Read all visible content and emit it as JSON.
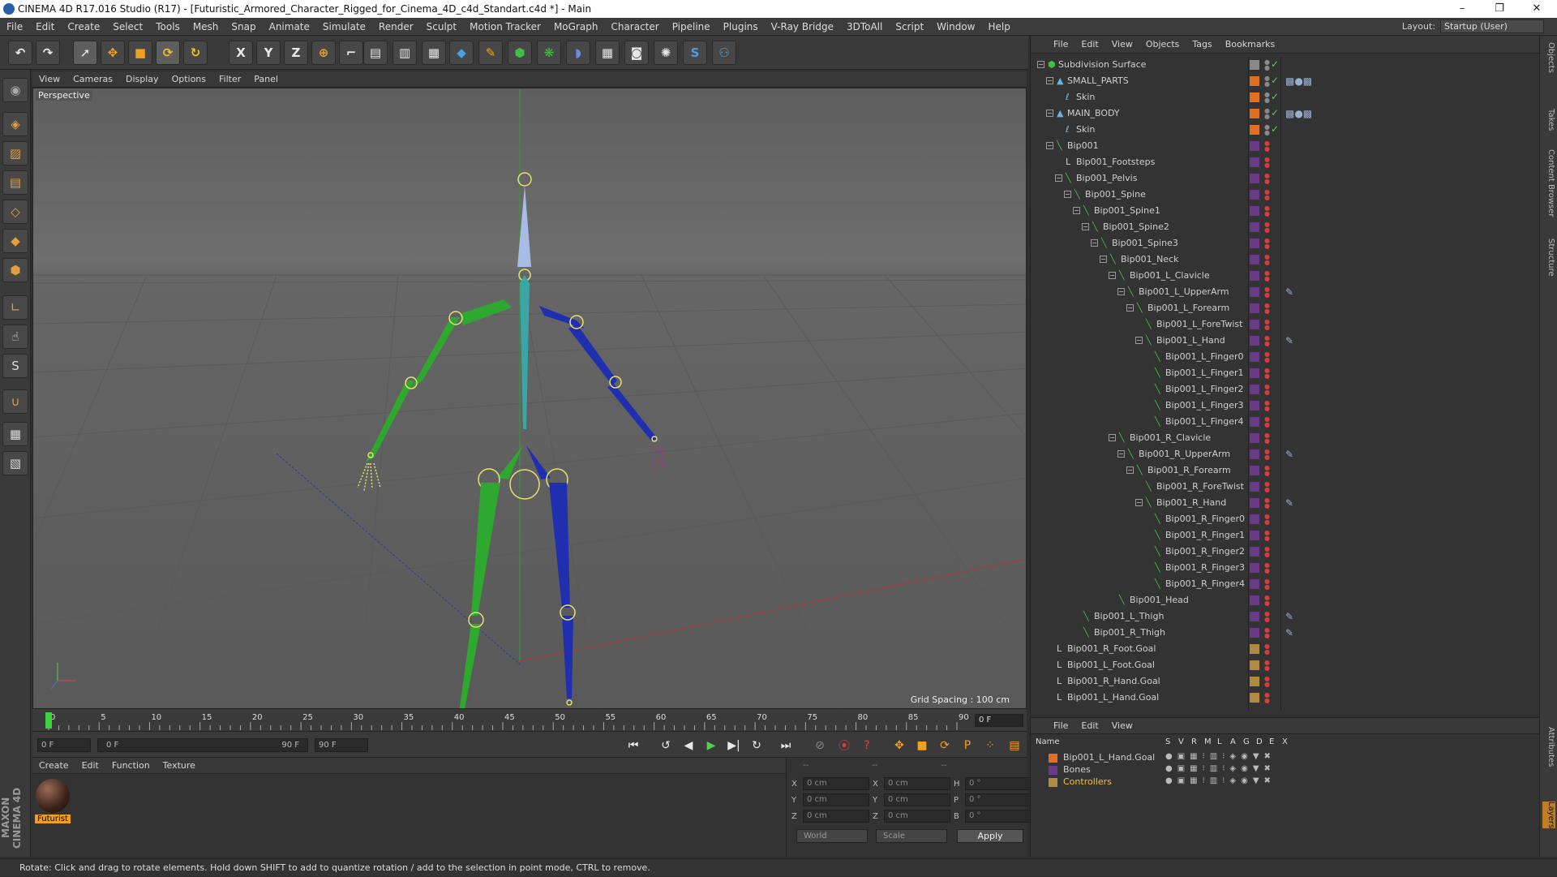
{
  "window": {
    "title": "CINEMA 4D R17.016 Studio (R17) - [Futuristic_Armored_Character_Rigged_for_Cinema_4D_c4d_Standart.c4d *] - Main"
  },
  "menubar": {
    "items": [
      "File",
      "Edit",
      "Create",
      "Select",
      "Tools",
      "Mesh",
      "Snap",
      "Animate",
      "Simulate",
      "Render",
      "Sculpt",
      "Motion Tracker",
      "MoGraph",
      "Character",
      "Pipeline",
      "Plugins",
      "V-Ray Bridge",
      "3DToAll",
      "Script",
      "Window",
      "Help"
    ],
    "layout_label": "Layout:",
    "layout_value": "Startup (User)"
  },
  "viewport": {
    "menu": [
      "View",
      "Cameras",
      "Display",
      "Options",
      "Filter",
      "Panel"
    ],
    "label": "Perspective",
    "grid_spacing": "Grid Spacing : 100 cm"
  },
  "timeline": {
    "ticks": [
      "0",
      "5",
      "10",
      "15",
      "20",
      "25",
      "30",
      "35",
      "40",
      "45",
      "50",
      "55",
      "60",
      "65",
      "70",
      "75",
      "80",
      "85",
      "90"
    ],
    "current": "0 F",
    "start": "0 F",
    "range_start": "0 F",
    "range_end": "90 F",
    "end": "90 F"
  },
  "materials": {
    "menu": [
      "Create",
      "Edit",
      "Function",
      "Texture"
    ],
    "items": [
      {
        "name": "Futurist"
      }
    ]
  },
  "coords": {
    "header": [
      "--",
      "--",
      "--"
    ],
    "rows": [
      {
        "a": "X",
        "av": "0 cm",
        "b": "X",
        "bv": "0 cm",
        "c": "H",
        "cv": "0 °"
      },
      {
        "a": "Y",
        "av": "0 cm",
        "b": "Y",
        "bv": "0 cm",
        "c": "P",
        "cv": "0 °"
      },
      {
        "a": "Z",
        "av": "0 cm",
        "b": "Z",
        "bv": "0 cm",
        "c": "B",
        "cv": "0 °"
      }
    ],
    "space": "World",
    "mode": "Scale",
    "apply": "Apply"
  },
  "object_manager": {
    "menu": [
      "File",
      "Edit",
      "View",
      "Objects",
      "Tags",
      "Bookmarks"
    ],
    "rows": [
      {
        "name": "Subdivision Surface",
        "depth": 0,
        "color": "#888888",
        "icon": "subdivision"
      },
      {
        "name": "SMALL_PARTS",
        "depth": 1,
        "color": "#e07020",
        "icon": "mesh"
      },
      {
        "name": "Skin",
        "depth": 2,
        "color": "#e07020",
        "icon": "skin"
      },
      {
        "name": "MAIN_BODY",
        "depth": 1,
        "color": "#e07020",
        "icon": "mesh"
      },
      {
        "name": "Skin",
        "depth": 2,
        "color": "#e07020",
        "icon": "skin"
      },
      {
        "name": "Bip001",
        "depth": 1,
        "color": "#6a3a8a",
        "icon": "bone"
      },
      {
        "name": "Bip001_Footsteps",
        "depth": 2,
        "color": "#6a3a8a",
        "icon": "null"
      },
      {
        "name": "Bip001_Pelvis",
        "depth": 2,
        "color": "#6a3a8a",
        "icon": "bone"
      },
      {
        "name": "Bip001_Spine",
        "depth": 3,
        "color": "#6a3a8a",
        "icon": "bone"
      },
      {
        "name": "Bip001_Spine1",
        "depth": 4,
        "color": "#6a3a8a",
        "icon": "bone"
      },
      {
        "name": "Bip001_Spine2",
        "depth": 5,
        "color": "#6a3a8a",
        "icon": "bone"
      },
      {
        "name": "Bip001_Spine3",
        "depth": 6,
        "color": "#6a3a8a",
        "icon": "bone"
      },
      {
        "name": "Bip001_Neck",
        "depth": 7,
        "color": "#6a3a8a",
        "icon": "bone"
      },
      {
        "name": "Bip001_L_Clavicle",
        "depth": 8,
        "color": "#6a3a8a",
        "icon": "bone"
      },
      {
        "name": "Bip001_L_UpperArm",
        "depth": 9,
        "color": "#6a3a8a",
        "icon": "bone"
      },
      {
        "name": "Bip001_L_Forearm",
        "depth": 10,
        "color": "#6a3a8a",
        "icon": "bone"
      },
      {
        "name": "Bip001_L_ForeTwist",
        "depth": 11,
        "color": "#6a3a8a",
        "icon": "bone"
      },
      {
        "name": "Bip001_L_Hand",
        "depth": 11,
        "color": "#6a3a8a",
        "icon": "bone"
      },
      {
        "name": "Bip001_L_Finger0",
        "depth": 12,
        "color": "#6a3a8a",
        "icon": "bone"
      },
      {
        "name": "Bip001_L_Finger1",
        "depth": 12,
        "color": "#6a3a8a",
        "icon": "bone"
      },
      {
        "name": "Bip001_L_Finger2",
        "depth": 12,
        "color": "#6a3a8a",
        "icon": "bone"
      },
      {
        "name": "Bip001_L_Finger3",
        "depth": 12,
        "color": "#6a3a8a",
        "icon": "bone"
      },
      {
        "name": "Bip001_L_Finger4",
        "depth": 12,
        "color": "#6a3a8a",
        "icon": "bone"
      },
      {
        "name": "Bip001_R_Clavicle",
        "depth": 8,
        "color": "#6a3a8a",
        "icon": "bone"
      },
      {
        "name": "Bip001_R_UpperArm",
        "depth": 9,
        "color": "#6a3a8a",
        "icon": "bone"
      },
      {
        "name": "Bip001_R_Forearm",
        "depth": 10,
        "color": "#6a3a8a",
        "icon": "bone"
      },
      {
        "name": "Bip001_R_ForeTwist",
        "depth": 11,
        "color": "#6a3a8a",
        "icon": "bone"
      },
      {
        "name": "Bip001_R_Hand",
        "depth": 11,
        "color": "#6a3a8a",
        "icon": "bone"
      },
      {
        "name": "Bip001_R_Finger0",
        "depth": 12,
        "color": "#6a3a8a",
        "icon": "bone"
      },
      {
        "name": "Bip001_R_Finger1",
        "depth": 12,
        "color": "#6a3a8a",
        "icon": "bone"
      },
      {
        "name": "Bip001_R_Finger2",
        "depth": 12,
        "color": "#6a3a8a",
        "icon": "bone"
      },
      {
        "name": "Bip001_R_Finger3",
        "depth": 12,
        "color": "#6a3a8a",
        "icon": "bone"
      },
      {
        "name": "Bip001_R_Finger4",
        "depth": 12,
        "color": "#6a3a8a",
        "icon": "bone"
      },
      {
        "name": "Bip001_Head",
        "depth": 8,
        "color": "#6a3a8a",
        "icon": "bone"
      },
      {
        "name": "Bip001_L_Thigh",
        "depth": 4,
        "color": "#6a3a8a",
        "icon": "bone"
      },
      {
        "name": "Bip001_R_Thigh",
        "depth": 4,
        "color": "#6a3a8a",
        "icon": "bone"
      },
      {
        "name": "Bip001_R_Foot.Goal",
        "depth": 1,
        "color": "#b08a40",
        "icon": "null"
      },
      {
        "name": "Bip001_L_Foot.Goal",
        "depth": 1,
        "color": "#b08a40",
        "icon": "null"
      },
      {
        "name": "Bip001_R_Hand.Goal",
        "depth": 1,
        "color": "#b08a40",
        "icon": "null"
      },
      {
        "name": "Bip001_L_Hand.Goal",
        "depth": 1,
        "color": "#b08a40",
        "icon": "null"
      }
    ]
  },
  "layer_manager": {
    "menu": [
      "File",
      "Edit",
      "View"
    ],
    "columns": [
      "Name",
      "S",
      "V",
      "R",
      "M",
      "L",
      "A",
      "G",
      "D",
      "E",
      "X"
    ],
    "layers": [
      {
        "name": "Bip001_L_Hand.Goal",
        "color": "#e07020"
      },
      {
        "name": "Bones",
        "color": "#6a3a8a"
      },
      {
        "name": "Controllers",
        "color": "#b08a40"
      }
    ]
  },
  "right_tabs": [
    "Objects",
    "Takes",
    "Content Browser",
    "Structure",
    "Attributes",
    "Layers"
  ],
  "statusbar": {
    "text": "Rotate: Click and drag to rotate elements. Hold down SHIFT to add to quantize rotation / add to the selection in point mode, CTRL to remove."
  },
  "brand": "MAXON CINEMA 4D"
}
